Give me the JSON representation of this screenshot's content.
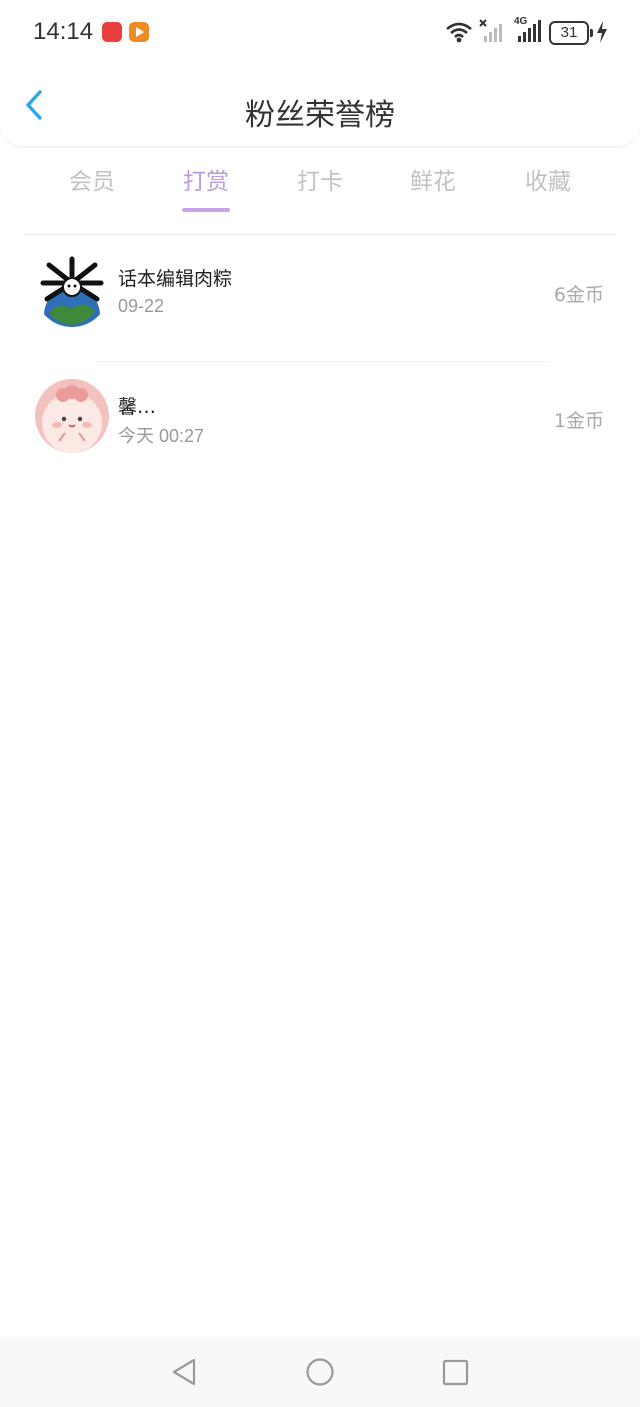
{
  "status_bar": {
    "time": "14:14",
    "battery": "31",
    "network": "4G"
  },
  "header": {
    "title": "粉丝荣誉榜"
  },
  "tabs": [
    {
      "label": "会员"
    },
    {
      "label": "打赏"
    },
    {
      "label": "打卡"
    },
    {
      "label": "鲜花"
    },
    {
      "label": "收藏"
    }
  ],
  "active_tab": "打赏",
  "list": [
    {
      "name": "话本编辑肉粽",
      "date": "09-22",
      "amount": "6金币"
    },
    {
      "name": "馨…",
      "date": "今天 00:27",
      "amount": "1金币"
    }
  ],
  "colors": {
    "accent": "#b99be0",
    "back_arrow": "#2aa7e8"
  }
}
